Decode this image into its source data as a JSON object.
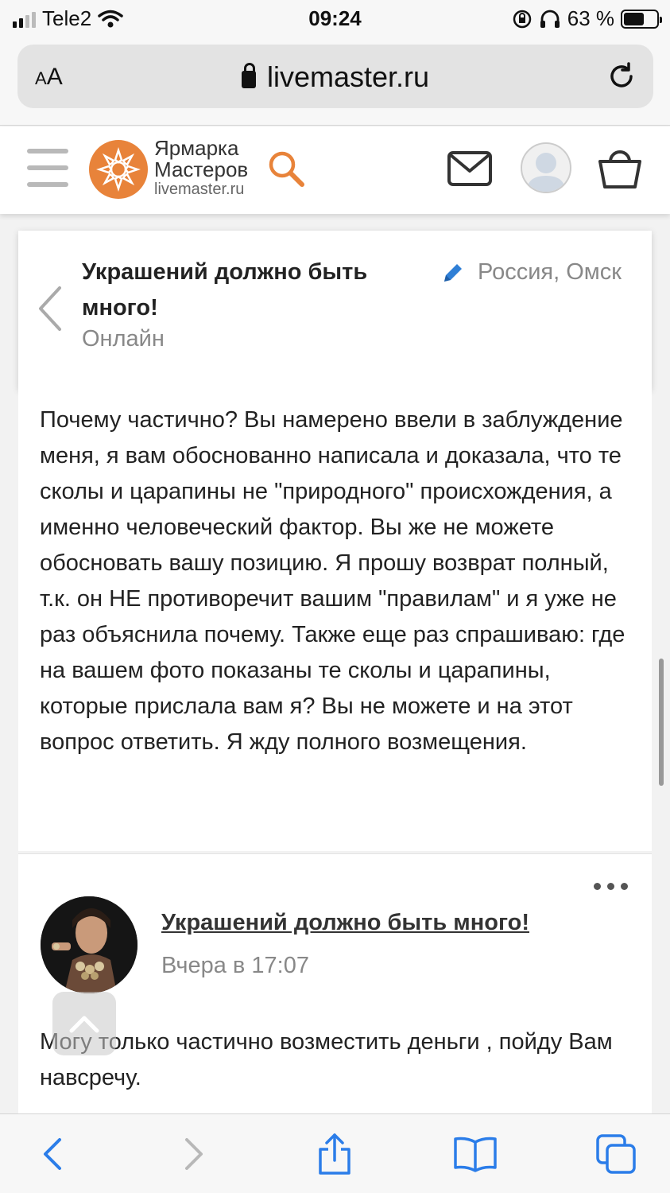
{
  "status_bar": {
    "carrier": "Tele2",
    "time": "09:24",
    "battery_text": "63 %",
    "battery_level": 0.63
  },
  "browser": {
    "text_size_label": "AA",
    "url": "livemaster.ru"
  },
  "site_header": {
    "logo_line1": "Ярмарка",
    "logo_line2": "Мастеров",
    "logo_domain": "livemaster.ru",
    "accent_color": "#e8833a"
  },
  "conversation": {
    "shop_name": "Украшений должно быть много!",
    "status": "Онлайн",
    "location": "Россия, Омск"
  },
  "messages": [
    {
      "text": "Почему частично? Вы намерено ввели в заблуждение меня, я вам обоснованно написала и доказала, что те сколы и царапины не \"природного\" происхождения, а именно человеческий фактор. Вы же не можете обосновать вашу позицию. Я прошу возврат полный, т.к. он НЕ противоречит вашим \"правилам\" и я уже не раз объяснила почему. Также еще раз спрашиваю: где на вашем фото показаны те сколы и царапины, которые прислала вам я? Вы не можете и на этот вопрос ответить. Я жду полного возмещения."
    },
    {
      "author": "Украшений должно быть много!",
      "time": "Вчера в 17:07",
      "text": "Могу только частично возместить деньги , пойду Вам навсречу."
    }
  ],
  "icons": {
    "signal": "signal-bars-icon",
    "wifi": "wifi-icon",
    "lock": "lock-icon",
    "reload": "reload-icon",
    "menu": "hamburger-menu-icon",
    "search": "search-icon",
    "mail": "mail-icon",
    "profile": "profile-icon",
    "cart": "cart-icon",
    "back": "chevron-left-icon",
    "edit": "pencil-icon",
    "more": "more-dots-icon",
    "scroll_up": "chevron-up-icon",
    "nav_back": "back-arrow-icon",
    "nav_forward": "forward-arrow-icon",
    "share": "share-icon",
    "bookmarks": "bookmarks-icon",
    "tabs": "tabs-icon"
  }
}
